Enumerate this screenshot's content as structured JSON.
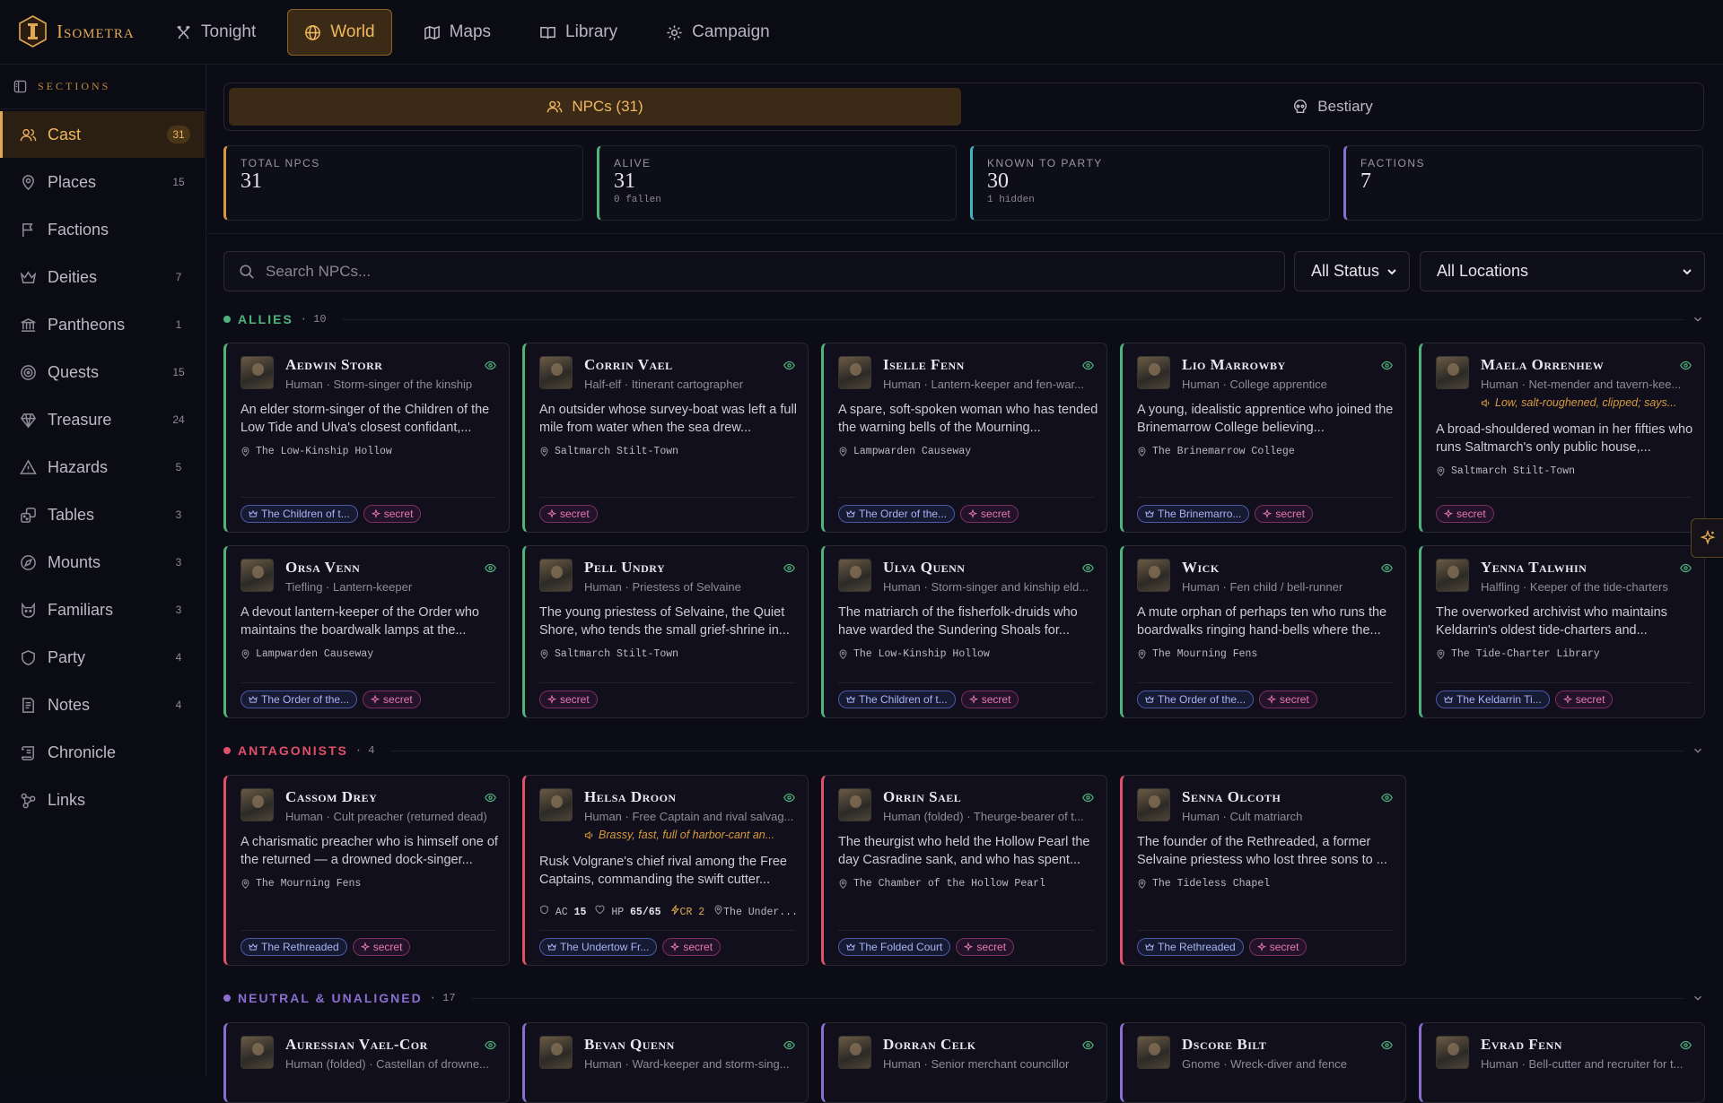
{
  "app": {
    "name": "Isometra"
  },
  "nav": {
    "tonight": "Tonight",
    "world": "World",
    "maps": "Maps",
    "library": "Library",
    "campaign": "Campaign"
  },
  "sidebar": {
    "heading": "SECTIONS",
    "items": [
      {
        "label": "Cast",
        "count": "31"
      },
      {
        "label": "Places",
        "count": "15"
      },
      {
        "label": "Factions",
        "count": ""
      },
      {
        "label": "Deities",
        "count": "7"
      },
      {
        "label": "Pantheons",
        "count": "1"
      },
      {
        "label": "Quests",
        "count": "15"
      },
      {
        "label": "Treasure",
        "count": "24"
      },
      {
        "label": "Hazards",
        "count": "5"
      },
      {
        "label": "Tables",
        "count": "3"
      },
      {
        "label": "Mounts",
        "count": "3"
      },
      {
        "label": "Familiars",
        "count": "3"
      },
      {
        "label": "Party",
        "count": "4"
      },
      {
        "label": "Notes",
        "count": "4"
      },
      {
        "label": "Chronicle",
        "count": ""
      },
      {
        "label": "Links",
        "count": ""
      }
    ]
  },
  "tabs": {
    "npcs": "NPCs (31)",
    "bestiary": "Bestiary"
  },
  "stats": [
    {
      "label": "TOTAL NPCS",
      "value": "31",
      "sub": "",
      "color": "#d89a3e"
    },
    {
      "label": "ALIVE",
      "value": "31",
      "sub": "0 fallen",
      "color": "#4fb37c"
    },
    {
      "label": "KNOWN TO PARTY",
      "value": "30",
      "sub": "1 hidden",
      "color": "#3fb3c2"
    },
    {
      "label": "FACTIONS",
      "value": "7",
      "sub": "",
      "color": "#8a6fd0"
    }
  ],
  "search": {
    "placeholder": "Search NPCs..."
  },
  "filters": {
    "status": "All Status",
    "locations": "All Locations"
  },
  "colors": {
    "allies": "#4fb37c",
    "antagonists": "#e0506a",
    "neutral": "#8a6fd0"
  },
  "groups": {
    "allies": {
      "label": "ALLIES",
      "count": "· 10"
    },
    "antagonists": {
      "label": "ANTAGONISTS",
      "count": "· 4"
    },
    "neutral": {
      "label": "NEUTRAL & UNALIGNED",
      "count": "· 17"
    }
  },
  "allies": [
    {
      "name": "Aedwin Storr",
      "sub": "Human · Storm-singer of the kinship",
      "desc": "An elder storm-singer of the Children of the Low Tide and Ulva's closest confidant,...",
      "loc": "The Low-Kinship Hollow",
      "faction": "The Children of t...",
      "secret": "secret"
    },
    {
      "name": "Corrin Vael",
      "sub": "Half-elf · Itinerant cartographer",
      "desc": "An outsider whose survey-boat was left a full mile from water when the sea drew...",
      "loc": "Saltmarch Stilt-Town",
      "faction": "",
      "secret": "secret"
    },
    {
      "name": "Iselle Fenn",
      "sub": "Human · Lantern-keeper and fen-war...",
      "desc": "A spare, soft-spoken woman who has tended the warning bells of the Mourning...",
      "loc": "Lampwarden Causeway",
      "faction": "The Order of the...",
      "secret": "secret"
    },
    {
      "name": "Lio Marrowby",
      "sub": "Human · College apprentice",
      "desc": "A young, idealistic apprentice who joined the Brinemarrow College believing...",
      "loc": "The Brinemarrow College",
      "faction": "The Brinemarro...",
      "secret": "secret"
    },
    {
      "name": "Maela Orrenhew",
      "sub": "Human · Net-mender and tavern-kee...",
      "voice": "Low, salt-roughened, clipped; says...",
      "desc": "A broad-shouldered woman in her fifties who runs Saltmarch's only public house,...",
      "loc": "Saltmarch Stilt-Town",
      "faction": "",
      "secret": "secret"
    },
    {
      "name": "Orsa Venn",
      "sub": "Tiefling · Lantern-keeper",
      "desc": "A devout lantern-keeper of the Order who maintains the boardwalk lamps at the...",
      "loc": "Lampwarden Causeway",
      "faction": "The Order of the...",
      "secret": "secret"
    },
    {
      "name": "Pell Undry",
      "sub": "Human · Priestess of Selvaine",
      "desc": "The young priestess of Selvaine, the Quiet Shore, who tends the small grief-shrine in...",
      "loc": "Saltmarch Stilt-Town",
      "faction": "",
      "secret": "secret"
    },
    {
      "name": "Ulva Quenn",
      "sub": "Human · Storm-singer and kinship eld...",
      "desc": "The matriarch of the fisherfolk-druids who have warded the Sundering Shoals for...",
      "loc": "The Low-Kinship Hollow",
      "faction": "The Children of t...",
      "secret": "secret"
    },
    {
      "name": "Wick",
      "sub": "Human · Fen child / bell-runner",
      "desc": "A mute orphan of perhaps ten who runs the boardwalks ringing hand-bells where the...",
      "loc": "The Mourning Fens",
      "faction": "The Order of the...",
      "secret": "secret"
    },
    {
      "name": "Yenna Talwhin",
      "sub": "Halfling · Keeper of the tide-charters",
      "desc": "The overworked archivist who maintains Keldarrin's oldest tide-charters and...",
      "loc": "The Tide-Charter Library",
      "faction": "The Keldarrin Ti...",
      "secret": "secret"
    }
  ],
  "antagonists": [
    {
      "name": "Cassom Drey",
      "sub": "Human · Cult preacher (returned dead)",
      "desc": "A charismatic preacher who is himself one of the returned — a drowned dock-singer...",
      "loc": "The Mourning Fens",
      "faction": "The Rethreaded",
      "secret": "secret"
    },
    {
      "name": "Helsa Droon",
      "sub": "Human · Free Captain and rival salvag...",
      "voice": "Brassy, fast, full of harbor-cant an...",
      "desc": "Rusk Volgrane's chief rival among the Free Captains, commanding the swift cutter...",
      "ac": "15",
      "hp": "65/65",
      "cr": "CR 2",
      "loc": "The Under...",
      "faction": "The Undertow Fr...",
      "secret": "secret"
    },
    {
      "name": "Orrin Sael",
      "sub": "Human (folded) · Theurge-bearer of t...",
      "desc": "The theurgist who held the Hollow Pearl the day Casradine sank, and who has spent...",
      "loc": "The Chamber of the Hollow Pearl",
      "faction": "The Folded Court",
      "secret": "secret"
    },
    {
      "name": "Senna Olcoth",
      "sub": "Human · Cult matriarch",
      "desc": "The founder of the Rethreaded, a former Selvaine priestess who lost three sons to ...",
      "loc": "The Tideless Chapel",
      "faction": "The Rethreaded",
      "secret": "secret"
    }
  ],
  "neutral": [
    {
      "name": "Auressian Vael-Cor",
      "sub": "Human (folded) · Castellan of drowne..."
    },
    {
      "name": "Bevan Quenn",
      "sub": "Human · Ward-keeper and storm-sing..."
    },
    {
      "name": "Dorran Celk",
      "sub": "Human · Senior merchant councillor"
    },
    {
      "name": "Dscore Bilt",
      "sub": "Gnome · Wreck-diver and fence"
    },
    {
      "name": "Evrad Fenn",
      "sub": "Human · Bell-cutter and recruiter for t..."
    }
  ]
}
